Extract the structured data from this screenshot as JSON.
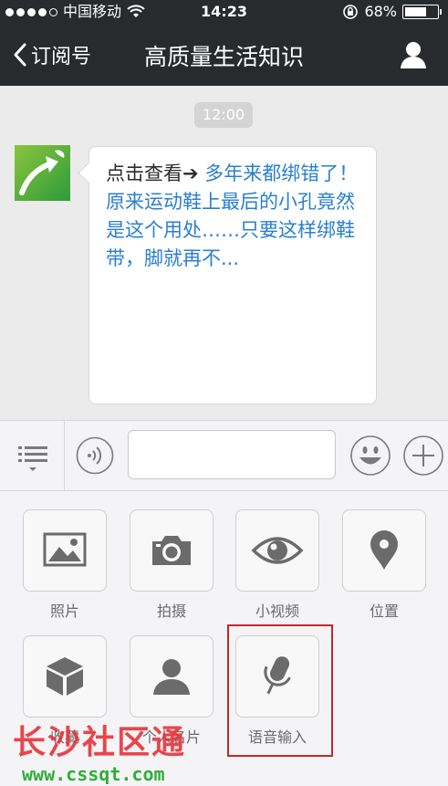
{
  "status_bar": {
    "carrier": "中国移动",
    "time": "14:23",
    "battery": "68%",
    "battery_level": 0.68
  },
  "nav": {
    "back_label": "订阅号",
    "title": "高质量生活知识"
  },
  "chat": {
    "timestamp": "12:00",
    "message_prefix": "点击查看➔ ",
    "message_link": "多年来都绑错了！原来运动鞋上最后的小孔竟然是这个用处……只要这样绑鞋带，脚就再不..."
  },
  "icons": {
    "avatar": "green-arrow-logo",
    "menu": "list-menu-icon",
    "voice": "voice-icon",
    "emoji": "smiley-icon",
    "plus": "plus-icon"
  },
  "panel": {
    "items": [
      {
        "label": "照片",
        "icon": "photo-icon"
      },
      {
        "label": "拍摄",
        "icon": "camera-icon"
      },
      {
        "label": "小视频",
        "icon": "eye-icon"
      },
      {
        "label": "位置",
        "icon": "location-pin-icon"
      },
      {
        "label": "收藏",
        "icon": "cube-icon"
      },
      {
        "label": "个人名片",
        "icon": "person-icon"
      },
      {
        "label": "语音输入",
        "icon": "microphone-icon"
      }
    ]
  },
  "watermark": {
    "title": "长沙社区通",
    "url": "www.cssqt.com"
  },
  "colors": {
    "bar_bg": "#282b2e",
    "link": "#2a7fd0",
    "highlight": "#c7252b",
    "icon_gray": "#6b6b6b"
  }
}
